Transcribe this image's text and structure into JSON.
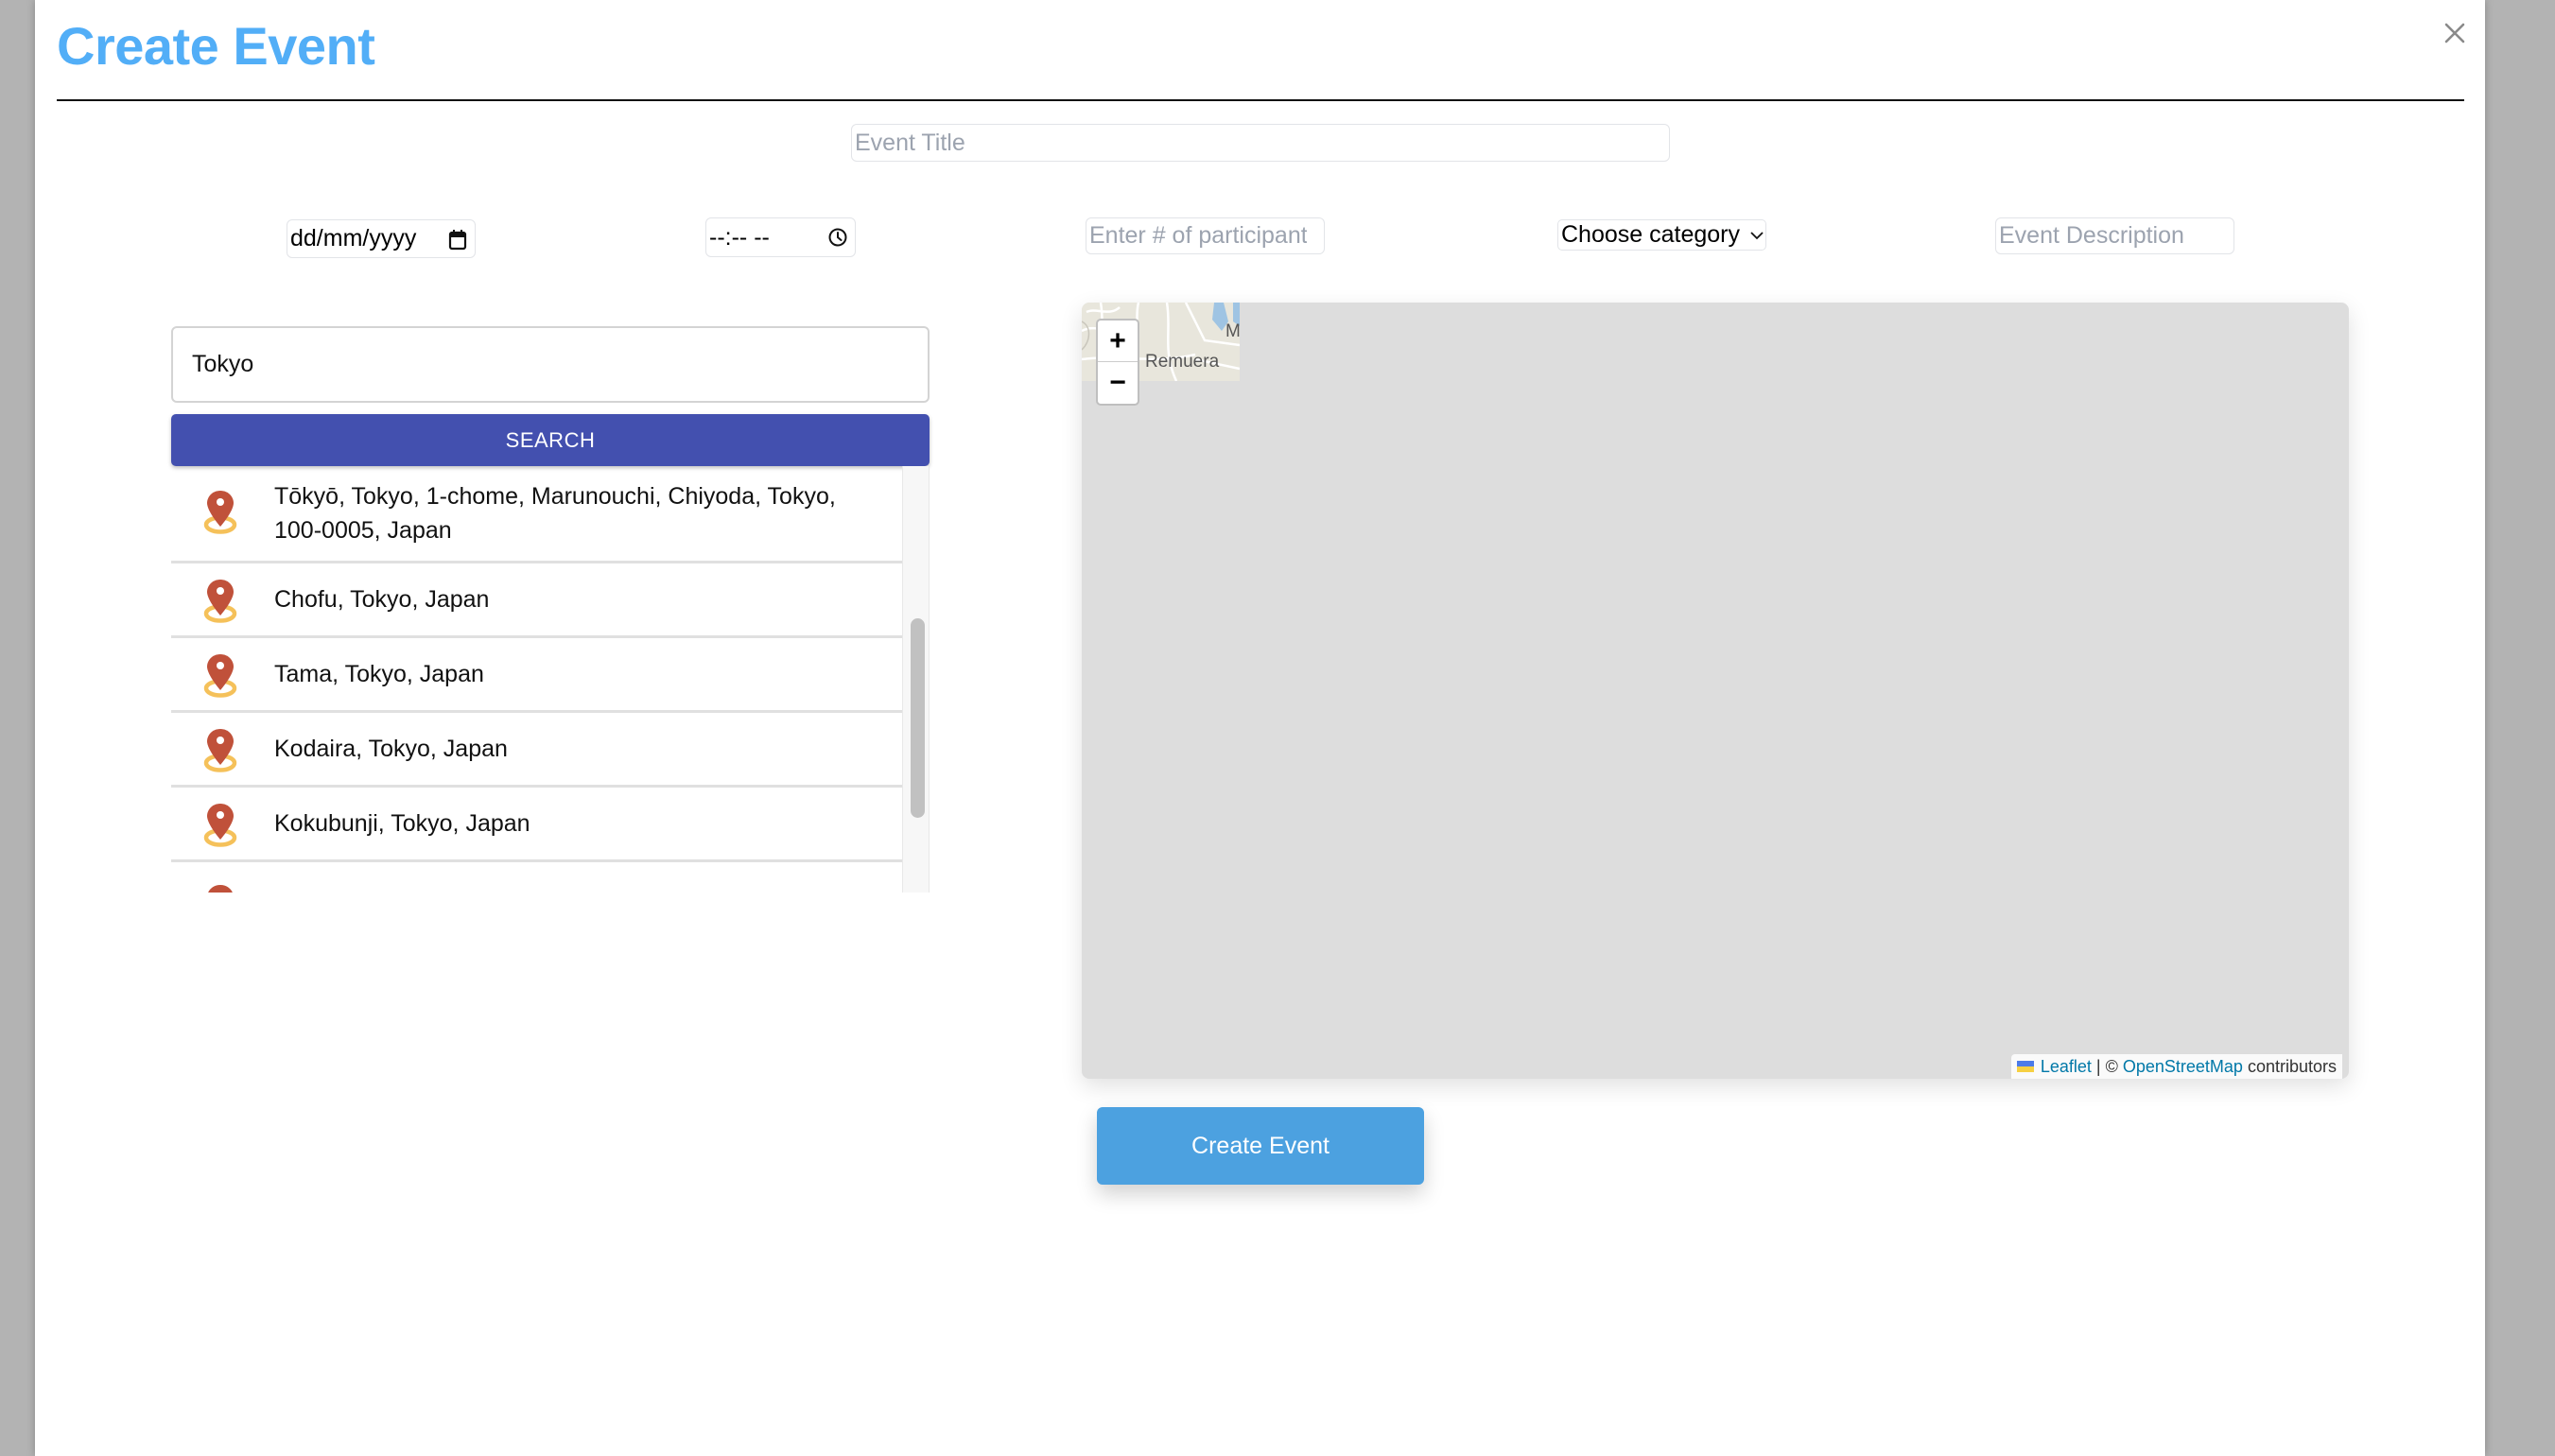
{
  "modal": {
    "title": "Create Event",
    "close_icon": "close-icon"
  },
  "form": {
    "event_title": {
      "value": "",
      "placeholder": "Event Title"
    },
    "date": {
      "display": "dd/mm/yyyy",
      "icon": "calendar-icon"
    },
    "time": {
      "display": "--:-- --",
      "icon": "clock-icon"
    },
    "participants": {
      "value": "",
      "placeholder": "Enter # of participants"
    },
    "category": {
      "selected": "Choose category",
      "icon": "chevron-down-icon"
    },
    "description": {
      "value": "",
      "placeholder": "Event Description"
    }
  },
  "location_search": {
    "query": "Tokyo",
    "button_label": "SEARCH",
    "results": [
      {
        "label": "Tōkyō, Tokyo, 1-chome, Marunouchi, Chiyoda, Tokyo, 100-0005, Japan",
        "icon": "map-pin-icon"
      },
      {
        "label": "Chofu, Tokyo, Japan",
        "icon": "map-pin-icon"
      },
      {
        "label": "Tama, Tokyo, Japan",
        "icon": "map-pin-icon"
      },
      {
        "label": "Kodaira, Tokyo, Japan",
        "icon": "map-pin-icon"
      },
      {
        "label": "Kokubunji, Tokyo, Japan",
        "icon": "map-pin-icon"
      }
    ]
  },
  "map": {
    "zoom_in_label": "+",
    "zoom_out_label": "−",
    "tile_place_label": "Remuera",
    "tile_partial_label": "M",
    "attribution": {
      "leaflet": "Leaflet",
      "separator": "| ©",
      "osm": "OpenStreetMap",
      "suffix": "contributors"
    }
  },
  "actions": {
    "create_label": "Create Event"
  },
  "colors": {
    "title": "#52aef7",
    "search_button": "#4350af",
    "create_button": "#4ca1e0",
    "pin": "#c0513a",
    "pin_ring": "#f5c15a",
    "backdrop": "#b3b3b3",
    "map_bg": "#dddddd"
  }
}
